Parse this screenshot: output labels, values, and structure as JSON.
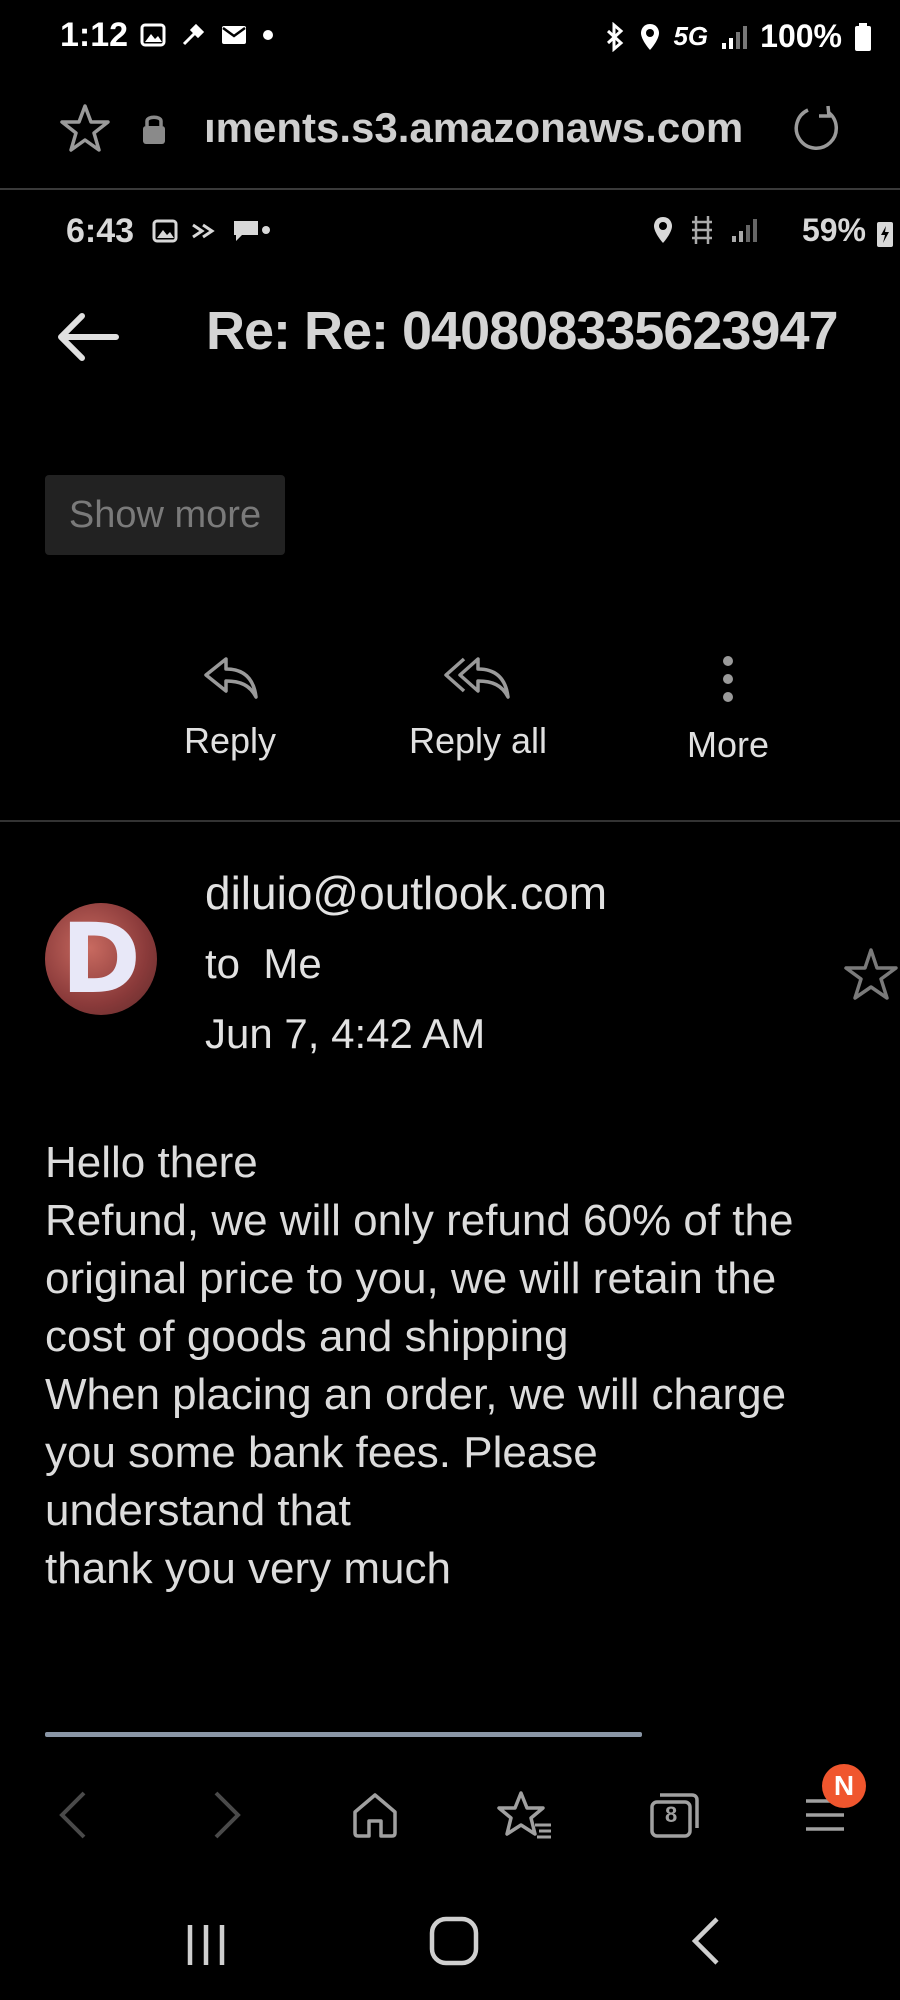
{
  "status_bar": {
    "time": "1:12",
    "network": "5G",
    "battery": "100%"
  },
  "url_bar": {
    "url": "ıments.s3.amazonaws.com"
  },
  "inner_status_bar": {
    "time": "6:43",
    "battery": "59%"
  },
  "email": {
    "subject": "Re: Re: 040808335623947",
    "show_more_label": "Show more",
    "actions": {
      "reply": "Reply",
      "reply_all": "Reply all",
      "more": "More"
    },
    "sender": "diluio@outlook.com",
    "avatar_letter": "D",
    "recipient": "to  Me",
    "date": "Jun 7, 4:42 AM",
    "body_lines": [
      "Hello there",
      "Refund, we will only refund 60% of the",
      "original price to you, we will retain the",
      "cost of goods and shipping",
      "When placing an order, we will charge",
      "you some bank fees. Please",
      "understand that",
      "thank you very much"
    ]
  },
  "browser_nav": {
    "tabs_count": "8",
    "menu_badge": "N"
  },
  "colors": {
    "background": "#000000",
    "badge": "#f0562e",
    "progress": "#8a96a6"
  }
}
